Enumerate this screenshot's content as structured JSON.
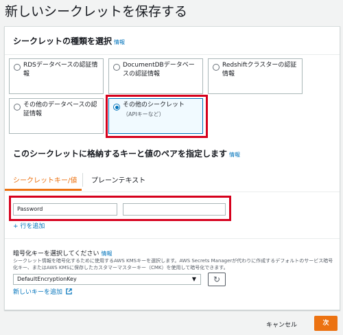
{
  "page_title": "新しいシークレットを保存する",
  "type_section": {
    "title": "シークレットの種類を選択",
    "info": "情報",
    "options": [
      {
        "label": "RDSデータベースの認証情報",
        "selected": false
      },
      {
        "label": "DocumentDBデータベースの認証情報",
        "selected": false
      },
      {
        "label": "Redshiftクラスターの認証情報",
        "selected": false
      },
      {
        "label": "その他のデータベースの認証情報",
        "selected": false
      },
      {
        "label": "その他のシークレット",
        "sublabel": "（APIキーなど）",
        "selected": true
      }
    ]
  },
  "kv_section": {
    "title": "このシークレットに格納するキーと値のペアを指定します",
    "info": "情報",
    "tabs": [
      {
        "label": "シークレットキー/値",
        "active": true
      },
      {
        "label": "プレーンテキスト",
        "active": false
      }
    ],
    "key_value": "Password",
    "value_value": "",
    "add_row": "+ 行を追加"
  },
  "encryption": {
    "title": "暗号化キーを選択してください",
    "info": "情報",
    "description": "シークレット情報を暗号化するために使用するAWS KMSキーを選択します。AWS Secrets Managerが代わりに作成するデフォルトのサービス暗号化キー、またはAWS KMSに保存したカスタマーマスターキー（CMK）を使用して暗号化できます。",
    "selected_key": "DefaultEncryptionKey",
    "new_key_link": "新しいキーを追加"
  },
  "footer": {
    "cancel_label": "キャンセル",
    "next_label": "次"
  },
  "colors": {
    "accent": "#ec7211",
    "link": "#0073bb",
    "highlight": "#d6001c"
  }
}
